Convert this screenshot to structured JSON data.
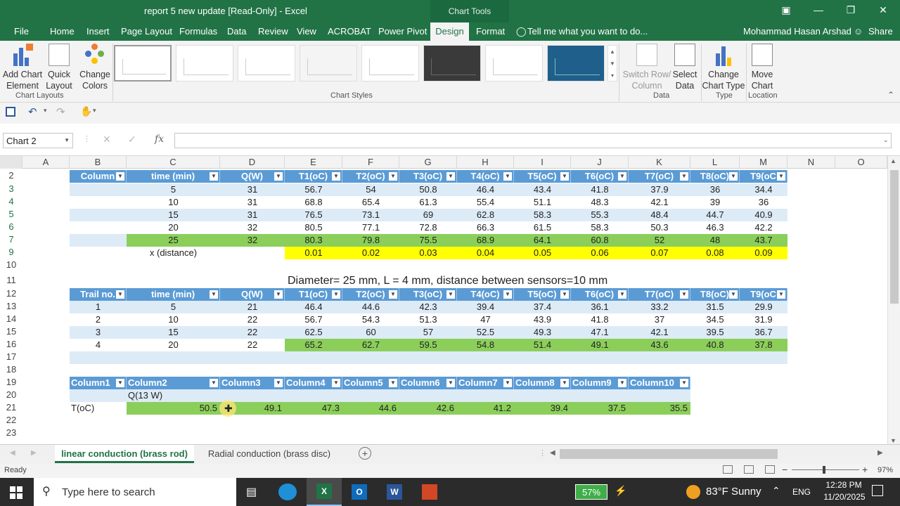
{
  "window": {
    "title": "report 5 new update  [Read-Only] - Excel",
    "context_tab_group": "Chart Tools"
  },
  "menu": {
    "items": [
      "File",
      "Home",
      "Insert",
      "Page Layout",
      "Formulas",
      "Data",
      "Review",
      "View",
      "ACROBAT",
      "Power Pivot",
      "Design",
      "Format"
    ],
    "active": "Design",
    "tell_me": "Tell me what you want to do...",
    "user": "Mohammad Hasan Arshad",
    "share": "Share"
  },
  "ribbon": {
    "add_chart_element": [
      "Add Chart",
      "Element"
    ],
    "quick_layout": [
      "Quick",
      "Layout"
    ],
    "change_colors": [
      "Change",
      "Colors"
    ],
    "switch_row_column": [
      "Switch Row/",
      "Column"
    ],
    "select_data": [
      "Select",
      "Data"
    ],
    "change_chart_type": [
      "Change",
      "Chart Type"
    ],
    "move_chart": [
      "Move",
      "Chart"
    ],
    "groups": {
      "chart_layouts": "Chart Layouts",
      "chart_styles": "Chart Styles",
      "data": "Data",
      "type": "Type",
      "location": "Location"
    }
  },
  "formula_bar": {
    "name_box": "Chart 2",
    "fx": "fx",
    "formula": ""
  },
  "columns": [
    "A",
    "B",
    "C",
    "D",
    "E",
    "F",
    "G",
    "H",
    "I",
    "J",
    "K",
    "L",
    "M",
    "N",
    "O"
  ],
  "rows": [
    "2",
    "3",
    "4",
    "5",
    "6",
    "7",
    "9",
    "10",
    "11",
    "12",
    "13",
    "14",
    "15",
    "16",
    "17",
    "18",
    "19",
    "20",
    "21",
    "22",
    "23"
  ],
  "table1": {
    "headers": [
      "Column",
      "time (min)",
      "Q(W)",
      "T1(oC)",
      "T2(oC)",
      "T3(oC)",
      "T4(oC)",
      "T5(oC)",
      "T6(oC)",
      "T7(oC)",
      "T8(oC)",
      "T9(oC"
    ],
    "rows": [
      [
        "",
        "5",
        "31",
        "56.7",
        "54",
        "50.8",
        "46.4",
        "43.4",
        "41.8",
        "37.9",
        "36",
        "34.4"
      ],
      [
        "",
        "10",
        "31",
        "68.8",
        "65.4",
        "61.3",
        "55.4",
        "51.1",
        "48.3",
        "42.1",
        "39",
        "36"
      ],
      [
        "",
        "15",
        "31",
        "76.5",
        "73.1",
        "69",
        "62.8",
        "58.3",
        "55.3",
        "48.4",
        "44.7",
        "40.9"
      ],
      [
        "",
        "20",
        "32",
        "80.5",
        "77.1",
        "72.8",
        "66.3",
        "61.5",
        "58.3",
        "50.3",
        "46.3",
        "42.2"
      ],
      [
        "",
        "25",
        "32",
        "80.3",
        "79.8",
        "75.5",
        "68.9",
        "64.1",
        "60.8",
        "52",
        "48",
        "43.7"
      ]
    ],
    "distance_label": "x (distance)",
    "distances": [
      "0.01",
      "0.02",
      "0.03",
      "0.04",
      "0.05",
      "0.06",
      "0.07",
      "0.08",
      "0.09"
    ]
  },
  "diameter_note": "Diameter= 25 mm, L =  4 mm, distance between sensors=10 mm",
  "table2": {
    "headers": [
      "Trail no.",
      "time (min)",
      "Q(W)",
      "T1(oC)",
      "T2(oC)",
      "T3(oC)",
      "T4(oC)",
      "T5(oC)",
      "T6(oC)",
      "T7(oC)",
      "T8(oC)",
      "T9(oC"
    ],
    "rows": [
      [
        "1",
        "5",
        "21",
        "46.4",
        "44.6",
        "42.3",
        "39.4",
        "37.4",
        "36.1",
        "33.2",
        "31.5",
        "29.9"
      ],
      [
        "2",
        "10",
        "22",
        "56.7",
        "54.3",
        "51.3",
        "47",
        "43.9",
        "41.8",
        "37",
        "34.5",
        "31.9"
      ],
      [
        "3",
        "15",
        "22",
        "62.5",
        "60",
        "57",
        "52.5",
        "49.3",
        "47.1",
        "42.1",
        "39.5",
        "36.7"
      ],
      [
        "4",
        "20",
        "22",
        "65.2",
        "62.7",
        "59.5",
        "54.8",
        "51.4",
        "49.1",
        "43.6",
        "40.8",
        "37.8"
      ]
    ]
  },
  "table3": {
    "headers": [
      "Column1",
      "Column2",
      "Column3",
      "Column4",
      "Column5",
      "Column6",
      "Column7",
      "Column8",
      "Column9",
      "Column10"
    ],
    "row20": [
      "",
      "Q(13 W)"
    ],
    "row21_label": "T(oC)",
    "row21": [
      "50.5",
      "49.1",
      "47.3",
      "44.6",
      "42.6",
      "41.2",
      "39.4",
      "37.5",
      "35.5"
    ]
  },
  "sheets": {
    "active": "linear conduction (brass rod)",
    "other": "Radial conduction (brass disc)"
  },
  "status": {
    "ready": "Ready",
    "zoom": "97%"
  },
  "taskbar": {
    "search_placeholder": "Type here to search",
    "battery": "57%",
    "weather": "83°F  Sunny",
    "lang": "ENG",
    "time": "12:28 PM",
    "date": "11/20/2025"
  }
}
